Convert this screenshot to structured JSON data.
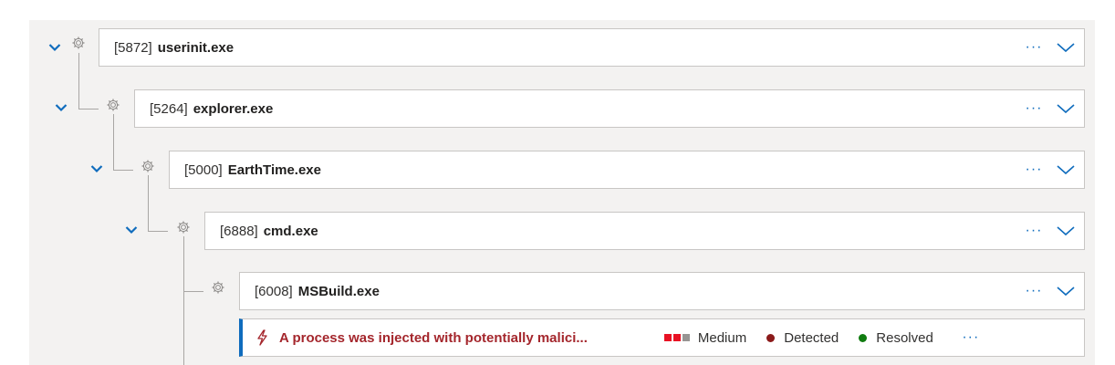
{
  "colors": {
    "accent": "#0f6cbd",
    "alert_title": "#a4262c",
    "severity_active": "#e81123",
    "severity_inactive": "#979593",
    "detected_dot": "#8b1a1a",
    "resolved_dot": "#107c10"
  },
  "icons": {
    "expand_toggle": "chevron-down-icon",
    "process": "gear-icon",
    "alert": "lightning-bolt-icon",
    "more": "more-options-icon"
  },
  "processes": [
    {
      "pid": "[5872]",
      "name": "userinit.exe"
    },
    {
      "pid": "[5264]",
      "name": "explorer.exe"
    },
    {
      "pid": "[5000]",
      "name": "EarthTime.exe"
    },
    {
      "pid": "[6888]",
      "name": "cmd.exe"
    },
    {
      "pid": "[6008]",
      "name": "MSBuild.exe"
    }
  ],
  "alert": {
    "title": "A process was injected with potentially malici...",
    "severity_label": "Medium",
    "severity_level": 2,
    "severity_max": 3,
    "detection_status": "Detected",
    "resolution_status": "Resolved"
  },
  "more_label": "···"
}
